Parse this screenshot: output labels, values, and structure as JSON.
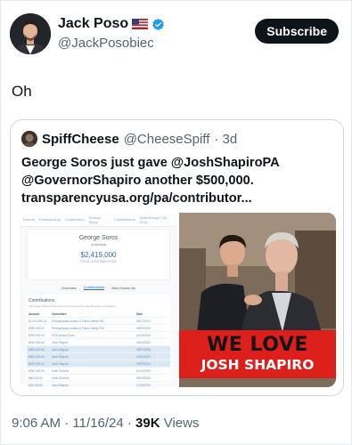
{
  "author": {
    "name": "Jack Poso",
    "flag_icon": "us-flag-icon",
    "verified_icon": "verified-badge-icon",
    "verified_color": "#1d9bf0",
    "handle": "@JackPosobiec"
  },
  "subscribe_label": "Subscribe",
  "tweet_text": "Oh",
  "quote": {
    "name": "SpiffCheese",
    "handle": "@CheeseSpiff",
    "time": "· 3d",
    "text_line1": "George Soros just gave @JoshShapiroPA",
    "text_line2": "@GovernorShapiro another $500,000.",
    "text_line3": "transparencyusa.org/pa/contributor...",
    "screenshot": {
      "nav": [
        "Donors",
        "Pennsylvania",
        "Contributors",
        "George Soros",
        "Contributions"
      ],
      "nav_right": "Data through: Q3 2024",
      "profile_name": "George Soros",
      "profile_type": "Individual",
      "amount": "$2,419,000",
      "amount_sub": "TOTAL CONTRIBUTIONS",
      "tabs": [
        "Overview",
        "Contributions",
        "Also Known As"
      ],
      "table_title": "Contributions",
      "table_subtitle": "This page includes information and documents regarding the contributions",
      "columns": [
        "Amount",
        "Committee",
        "Date"
      ],
      "rows": [
        {
          "amount": "$1,000,000.00",
          "committee": "Pennsylvania Justice & Public Safety PAC",
          "date": "05/17/2024"
        },
        {
          "amount": "$250,000.00",
          "committee": "Pennsylvania Justice & Public Safety PAC",
          "date": "05/09/2024"
        },
        {
          "amount": "$250,000.00",
          "committee": "DGA Victory Fund",
          "date": "04/19/2024"
        },
        {
          "amount": "$250,000.00",
          "committee": "Josh Shapiro",
          "date": "04/05/2022"
        },
        {
          "amount": "$500,000.00",
          "committee": "Josh Shapiro",
          "date": "09/27/2024"
        },
        {
          "amount": "$500,000.00",
          "committee": "Josh Shapiro",
          "date": "10/04/2024"
        },
        {
          "amount": "$500,000.00",
          "committee": "Josh Shapiro",
          "date": "09/25/2024"
        },
        {
          "amount": "$250,000.00",
          "committee": "Keith Rothfus",
          "date": "07/13/2022"
        },
        {
          "amount": "$50,000.00",
          "committee": "Keith Rothfus",
          "date": "09/19/2020"
        },
        {
          "amount": "$25,000.00",
          "committee": "Josh Shapiro",
          "date": "12/18/2019"
        }
      ]
    },
    "photo_banner_line1": "WE LOVE",
    "photo_banner_line2": "JOSH SHAPIRO",
    "banner_color": "#dd1f1c"
  },
  "meta": {
    "time": "9:06 AM",
    "sep1": " · ",
    "date": "11/16/24",
    "sep2": " · ",
    "views_count": "39K",
    "views_label": " Views"
  }
}
